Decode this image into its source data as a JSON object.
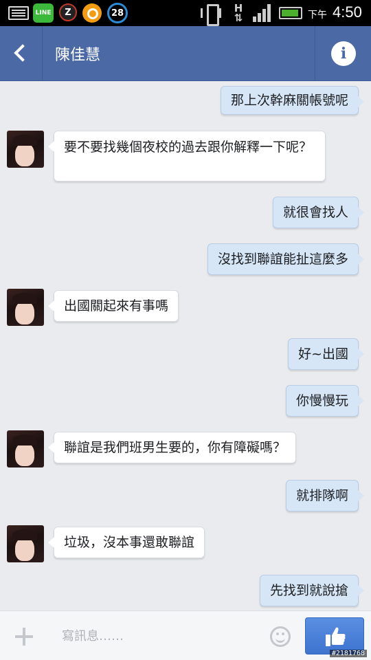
{
  "status_bar": {
    "line_label": "LINE",
    "z_label": "Z",
    "badge_count": "28",
    "network": "H",
    "ampm": "下午",
    "time": "4:50"
  },
  "header": {
    "title": "陳佳慧",
    "info_label": "i"
  },
  "messages": [
    {
      "side": "out",
      "text": "那上次幹麻關帳號呢"
    },
    {
      "side": "in",
      "text": "要不要找幾個夜校的過去跟你解釋一下呢？"
    },
    {
      "side": "out",
      "text": "就很會找人"
    },
    {
      "side": "out",
      "text": "沒找到聯誼能扯這麼多"
    },
    {
      "side": "in",
      "text": "出國關起來有事嗎"
    },
    {
      "side": "out",
      "text": "好~出國"
    },
    {
      "side": "out",
      "text": "你慢慢玩"
    },
    {
      "side": "in",
      "text": "聯誼是我們班男生要的，你有障礙嗎？"
    },
    {
      "side": "out",
      "text": "就排隊啊"
    },
    {
      "side": "in",
      "text": "垃圾，沒本事還敢聯誼"
    },
    {
      "side": "out",
      "text": "先找到就說搶"
    }
  ],
  "composer": {
    "placeholder": "寫訊息……",
    "value": ""
  },
  "watermark": "#2181768",
  "colors": {
    "header_bg": "#4b6aa5",
    "outgoing_bubble": "#d6e6f7",
    "incoming_bubble": "#ffffff",
    "chat_bg": "#e9ebee",
    "like_button": "#4a80d8"
  },
  "icons": {
    "back": "chevron-left-icon",
    "info": "info-icon",
    "add": "plus-icon",
    "emoji": "smiley-icon",
    "like": "thumbs-up-icon"
  }
}
